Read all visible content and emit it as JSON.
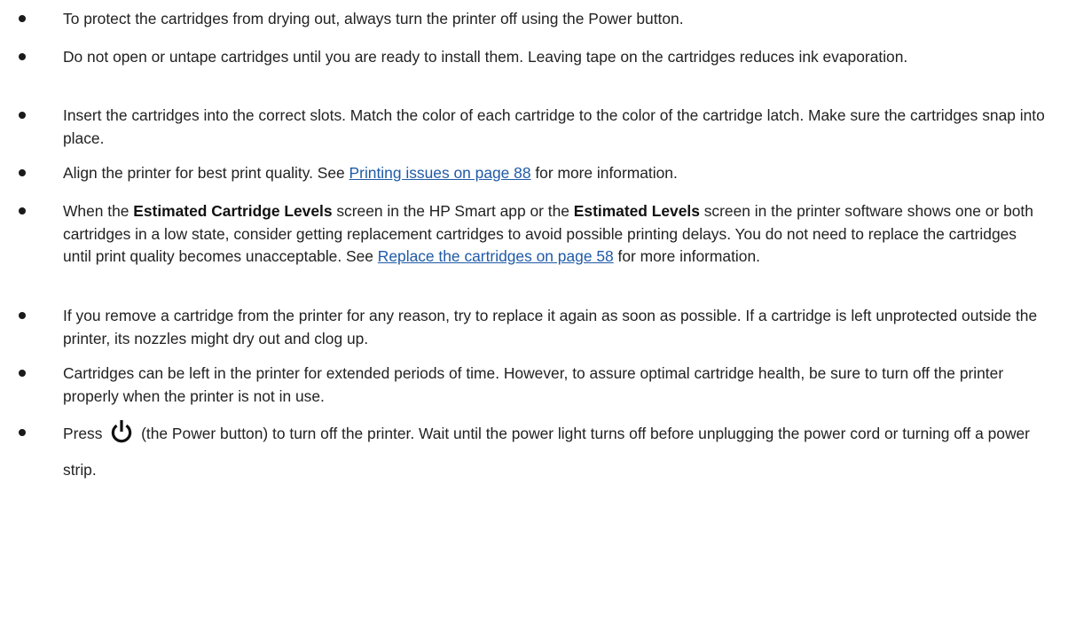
{
  "tips": [
    {
      "text": "To protect the cartridges from drying out, always turn the printer off using the Power button."
    },
    {
      "text": "Do not open or untape cartridges until you are ready to install them. Leaving tape on the cartridges reduces ink evaporation."
    },
    {
      "text": "Insert the cartridges into the correct slots. Match the color of each cartridge to the color of the cartridge latch. Make sure the cartridges snap into place."
    },
    {
      "before": "Align the printer for best print quality. See ",
      "link": "Printing issues on page 88",
      "after": " for more information."
    },
    {
      "part1": "When the ",
      "bold1": "Estimated Cartridge Levels",
      "part2": " screen in the HP Smart app or the ",
      "bold2": "Estimated Levels",
      "part3": " screen in the printer software shows one or both cartridges in a low state, consider getting replacement cartridges to avoid possible printing delays. You do not need to replace the cartridges until print quality becomes unacceptable. See ",
      "link": "Replace the cartridges on page 58",
      "part4": " for more information."
    },
    {
      "text": "If you remove a cartridge from the printer for any reason, try to replace it again as soon as possible. If a cartridge is left unprotected outside the printer, its nozzles might dry out and clog up."
    },
    {
      "text": "Cartridges can be left in the printer for extended periods of time. However, to assure optimal cartridge health, be sure to turn off the printer properly when the printer is not in use."
    },
    {
      "before": "Press ",
      "icon": "power-icon",
      "after": " (the Power button) to turn off the printer. Wait until the power light turns off before unplugging the power cord or turning off a power strip."
    }
  ],
  "colors": {
    "text": "#222222",
    "link": "#1f5aa6",
    "bullet": "#1a1a1a"
  }
}
